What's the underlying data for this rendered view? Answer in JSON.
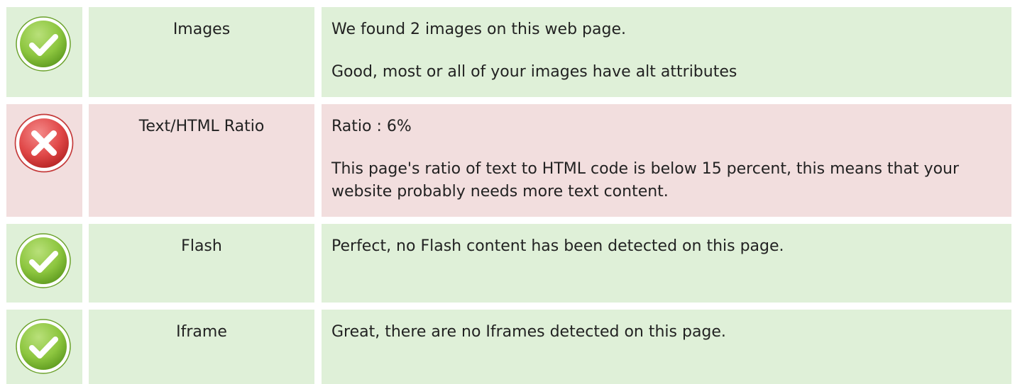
{
  "colors": {
    "pass_bg": "#dff0d8",
    "fail_bg": "#f2dede",
    "pass_icon": "#8dc63f",
    "fail_icon": "#e04848",
    "text": "#222222"
  },
  "rows": [
    {
      "status": "pass",
      "icon": "check-circle-icon",
      "name": "Images",
      "lines": [
        "We found 2 images on this web page.",
        "Good, most or all of your images have alt attributes"
      ]
    },
    {
      "status": "fail",
      "icon": "cross-circle-icon",
      "name": "Text/HTML Ratio",
      "lines": [
        "Ratio : 6%",
        "This page's ratio of text to HTML code is below 15 percent, this means that your website probably needs more text content."
      ]
    },
    {
      "status": "pass",
      "icon": "check-circle-icon",
      "name": "Flash",
      "lines": [
        "Perfect, no Flash content has been detected on this page."
      ]
    },
    {
      "status": "pass",
      "icon": "check-circle-icon",
      "name": "Iframe",
      "lines": [
        "Great, there are no Iframes detected on this page."
      ]
    }
  ]
}
